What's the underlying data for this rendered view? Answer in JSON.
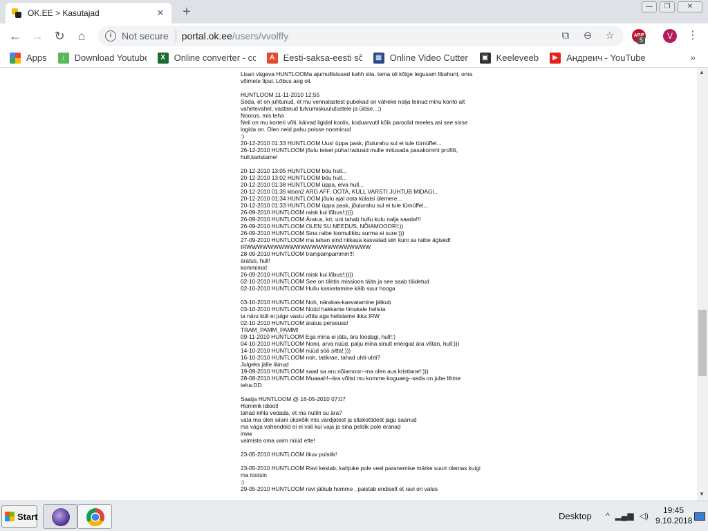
{
  "browser": {
    "tab_title": "OK.EE > Kasutajad",
    "close_tab": "✕",
    "new_tab": "+",
    "window": {
      "minimize": "—",
      "maximize": "❐",
      "close": "✕"
    },
    "url_status": "Not secure",
    "url_host": "portal.ok.ee",
    "url_path": "/users/vvolffy",
    "icons": {
      "translate": "translate-icon",
      "zoom": "zoom-icon",
      "star": "star-icon"
    },
    "ext_abp_label": "ABP",
    "ext_abp_count": "5",
    "avatar_letter": "V",
    "menu_glyph": "⋮"
  },
  "bookmarks": {
    "items": [
      {
        "label": "Apps",
        "icon": "apps-grid-icon"
      },
      {
        "label": "Download Youtube V",
        "icon": "download-icon"
      },
      {
        "label": "Online converter - co",
        "icon": "converter-icon"
      },
      {
        "label": "Eesti-saksa-eesti sõn",
        "icon": "dictionary-icon"
      },
      {
        "label": "Online Video Cutter -",
        "icon": "video-cutter-icon"
      },
      {
        "label": "Keeleveeb",
        "icon": "keeleveeb-icon"
      },
      {
        "label": "Андреич - YouTube",
        "icon": "youtube-icon"
      }
    ],
    "more": "»"
  },
  "page": {
    "lines": [
      "Lisan vägeva HUNTLOOMa ajumullistused kahh siia, tema oli kõige tegusam libahunt, oma",
      "võimete tipul. Lõbus aeg oli.",
      "",
      "HUNTLOOM 11-11-2010 12:55",
      "Seda, et on juhtunud, et mu vennalastest pubekad on väheke nalja teinud minu konto alt",
      "vahetevahel, vastanud tutvumiskuulutustele ja üldse...:)",
      "Noorus, mis teha",
      "Neil on mu korteri võti, käivad ligidal koolis, koduarvutil kõik paroolid meeles,asi see sisse",
      "logida on. Olen neid pahu poisse noominud",
      ":)",
      "20-12-2010 01:33 HUNTLOOM Uus! üppa pask, jõulurahu sul ei tule türnüffel...",
      "26-12-2010 HUNTLOOM jõulu teisel pühal ladusid mulle mitusada pasakommi profiili,",
      "hull,karistame!",
      "",
      "20-12-2010 13:05 HUNTLOOM böu hull...",
      "20-12-2010 13:02 HUNTLOOM böu hull...",
      "20-12-2010 01:38 HUNTLOOM üppa, elva hull...",
      "20-12-2010 01:35 kloon2 ARG AFF, OOTA, KÜLL VARSTI JUHTUB MIDAGI...",
      "20-12-2010 01:34 HUNTLOOM jõulu ajal oota külaisi ülemere...",
      "20-12-2010 01:33 HUNTLOOM üppa pask, jõulurahu sul ei tule türnüffel...",
      "26-09-2010 HUNTLOOM raisk kui lõbus!:))))",
      "26-09-2010 HUNTLOOM Äratus, krt, unt tahab hullu kulu nalja saada!!!",
      "26-09-2010 HUNTLOOM OLEN SU NEEDUS, NÕIAMOOOR!:))",
      "26-09-2010 HUNTLOOM Sina raibe loomulikku surma ei sure:)))",
      "27-09-2010 HUNTLOOM ma tahan sind niikaua kasvatad siin kuni sa raibe ägised!",
      "IRWWWWWWWWWWWWWWWWWWWWWWW",
      "28-09-2010 HUNTLOOM trampampammm!!!",
      "äratus, hull!",
      "kommima!",
      "26-09-2010 HUNTLOOM raisk kui lõbus!:))))",
      "02-10-2010 HUNTLOOM See on tähtis missioon täita ja see saab täidetud",
      "02-10-2010 HUNTLOOM Hullu kasvatamine käib suur hooga",
      "",
      "03-10-2010 HUNTLOOM Noh, närakas-kasvatamine jätkub",
      "03-10-2010 HUNTLOOM Nüüd hakkame limukale helista",
      "ta näru küll ei julge vastu võtta aga helistame ikka IRW",
      "02-10-2010 HUNTLOOM äratus perseuss!",
      "TRAM_PAMM_PAMM!",
      "09-11-2010 HUNTLOOM Ega mina ei jäta, ära loodagi, hull!:)",
      "04-10-2010 HUNTLOOM Nonii, arva nüüd, palju mina sinult energiat ära võtan, hull:)))",
      "14-10-2010 HUNTLOOM nüüd söö sitta!:)))",
      "16-10-2010 HUNTLOOM noh, tatikrae, tahad uhti-uhti?",
      "Julgeks jälle läinud",
      "19-09-2010 HUNTLOOM saad sa aru nõiamoor--ma olen aus kristlane!:)))",
      "28-08-2010 HUNTLOOM Muaaah!--ära võltsi mu komme koguaeg--seda on jube lihtne",
      "teha:DD",
      "",
      "Saatja HUNTLOOM @ 16-05-2010 07:07",
      "Hommik idioot!",
      "tahad kihla vedada, et ma nullin su ära?",
      "vata ma olen siiani ükskõik mis värdjatest ja sitakottidest jagu saanud",
      "ma väga vahendeid ei ei vali kui vaja ja sina peldik pole eranad",
      "irww",
      "valmista oma vaim nüüd ette!",
      "",
      "23-05-2010 HUNTLOOM ilkuv pulstik!",
      "",
      "23-05-2010 HUNTLOOM Ravi kestab, kahjuke pole veel paranemise märke suurt olemas kuigi",
      "ma lootsin",
      ":)",
      "29-05-2010 HUNTLOOM ravi jätkub homme , paistab endiselt et ravi on valus"
    ]
  },
  "taskbar": {
    "start_label": "Start",
    "desktop_label": "Desktop",
    "tray_expand": "^",
    "time": "19:45",
    "date": "9.10.2018"
  }
}
